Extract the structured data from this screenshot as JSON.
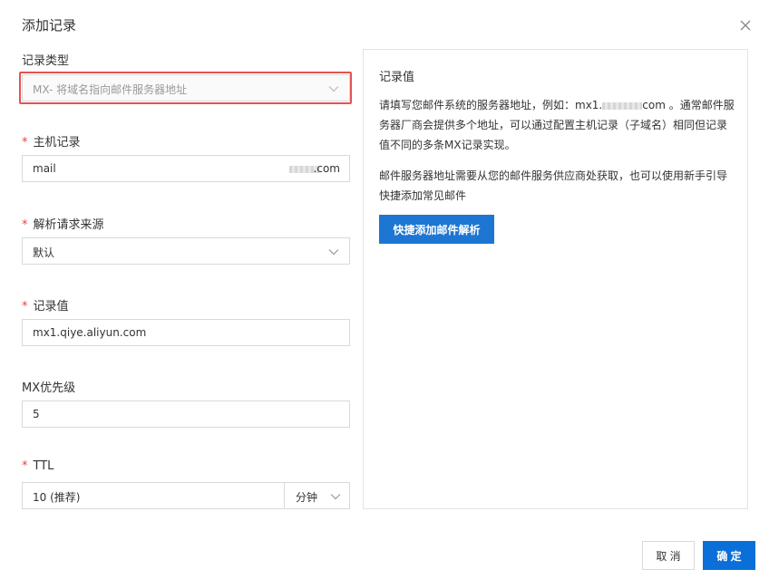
{
  "dialog": {
    "title": "添加记录"
  },
  "form": {
    "record_type": {
      "label": "记录类型",
      "value": "MX- 将域名指向邮件服务器地址"
    },
    "host": {
      "label": "主机记录",
      "value": "mail",
      "suffix": ".com"
    },
    "line": {
      "label": "解析请求来源",
      "value": "默认"
    },
    "value": {
      "label": "记录值",
      "value": "mx1.qiye.aliyun.com"
    },
    "mx_priority": {
      "label": "MX优先级",
      "value": "5"
    },
    "ttl": {
      "label": "TTL",
      "value": "10 (推荐)",
      "unit": "分钟"
    }
  },
  "panel": {
    "title": "记录值",
    "para1_a": "请填写您邮件系统的服务器地址，例如：mx1.",
    "para1_b": "com 。通常邮件服务器厂商会提供多个地址，可以通过配置主机记录（子域名）相同但记录值不同的多条MX记录实现。",
    "para2": "邮件服务器地址需要从您的邮件服务供应商处获取，也可以使用新手引导快捷添加常见邮件",
    "button": "快捷添加邮件解析"
  },
  "footer": {
    "cancel": "取 消",
    "ok": "确 定"
  },
  "colors": {
    "primary": "#0a6fd8",
    "required": "#e54545",
    "highlight": "#e35353"
  },
  "icons": {
    "close": "close-icon",
    "dropdown": "chevron-down-icon"
  }
}
